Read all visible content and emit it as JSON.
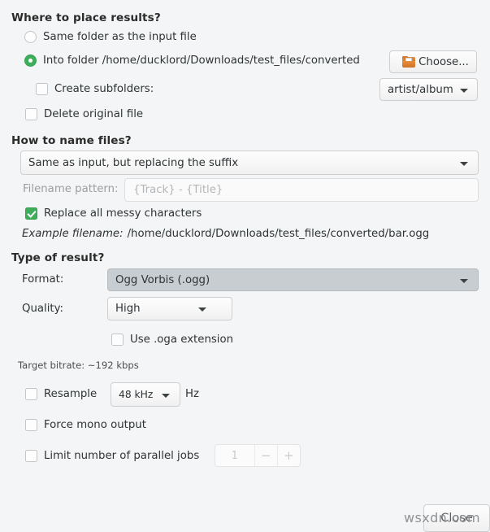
{
  "window": {
    "background_color": "#f4f5f6",
    "accent_color": "#3fae5a"
  },
  "sections": {
    "where": {
      "title": "Where to place results?",
      "radio_same_folder": "Same folder as the input file",
      "radio_into_folder": "Into folder /home/ducklord/Downloads/test_files/converted",
      "choose_button": "Choose...",
      "create_subfolders": "Create subfolders:",
      "subfolders_value": "artist/album",
      "delete_original": "Delete original file"
    },
    "naming": {
      "title": "How to name files?",
      "scheme_value": "Same as input, but replacing the suffix",
      "pattern_label": "Filename pattern:",
      "pattern_placeholder": "{Track} - {Title}",
      "replace_messy": "Replace all messy characters",
      "example_label": "Example filename:",
      "example_value": "/home/ducklord/Downloads/test_files/converted/bar.ogg"
    },
    "result": {
      "title": "Type of result?",
      "format_label": "Format:",
      "format_value": "Ogg Vorbis (.ogg)",
      "quality_label": "Quality:",
      "quality_value": "High",
      "use_oga": "Use .oga extension",
      "bitrate": "Target bitrate: ~192 kbps",
      "resample": "Resample",
      "resample_value": "48 kHz",
      "resample_unit": "Hz",
      "force_mono": "Force mono output",
      "limit_jobs": "Limit number of parallel jobs",
      "jobs_value": "1",
      "jobs_minus": "−",
      "jobs_plus": "+"
    }
  },
  "footer": {
    "close_button": "Close"
  },
  "watermark": {
    "text": "wsxdn.com"
  }
}
